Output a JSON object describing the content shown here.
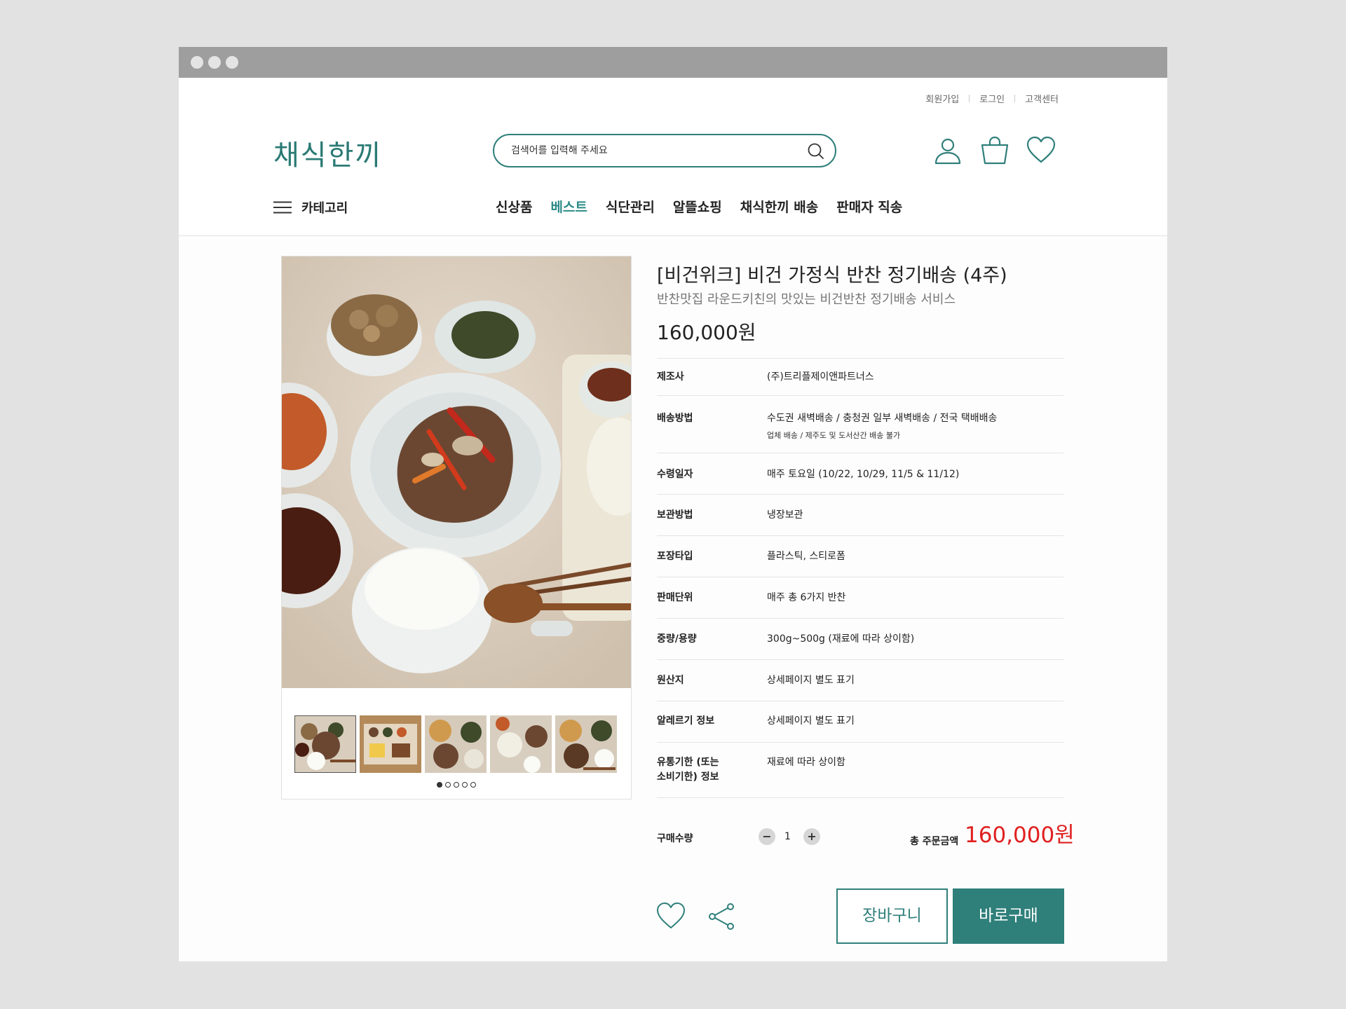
{
  "util_nav": [
    "회원가입",
    "로그인",
    "고객센터"
  ],
  "logo": "채식한끼",
  "search": {
    "placeholder": "검색어를 입력해 주세요"
  },
  "header_icons": [
    "user-icon",
    "shopping-bag-icon",
    "heart-icon"
  ],
  "category_label": "카테고리",
  "gnb": [
    "신상품",
    "베스트",
    "식단관리",
    "알뜰쇼핑",
    "채식한끼 배송",
    "판매자 직송"
  ],
  "gnb_active": "베스트",
  "product": {
    "title": "[비건위크] 비건 가정식 반찬 정기배송 (4주)",
    "subtitle": "반찬맛집 라운드키친의 맛있는 비건반찬 정기배송 서비스",
    "price": "160,000원"
  },
  "specs": [
    {
      "label": "제조사",
      "value": "(주)트리플제이앤파트너스"
    },
    {
      "label": "배송방법",
      "value": "수도권 새벽배송 / 충청권 일부 새벽배송 / 전국 택배배송",
      "note": "업체 배송 / 제주도 및 도서산간 배송 불가"
    },
    {
      "label": "수령일자",
      "value": "매주 토요일 (10/22, 10/29, 11/5 & 11/12)"
    },
    {
      "label": "보관방법",
      "value": "냉장보관"
    },
    {
      "label": "포장타입",
      "value": "플라스틱, 스티로폼"
    },
    {
      "label": "판매단위",
      "value": "매주 총 6가지 반찬"
    },
    {
      "label": "중량/용량",
      "value": "300g~500g (재료에 따라 상이함)"
    },
    {
      "label": "원산지",
      "value": "상세페이지 별도 표기"
    },
    {
      "label": "알레르기 정보",
      "value": "상세페이지 별도 표기"
    },
    {
      "label": "유통기한 (또는\n소비기한) 정보",
      "value": "재료에 따라 상이함"
    }
  ],
  "purchase": {
    "qty_label": "구매수량",
    "qty": "1",
    "minus": "−",
    "plus": "+",
    "total_label": "총 주문금액",
    "total_price": "160,000원",
    "cart_button": "장바구니",
    "buy_button": "바로구매"
  },
  "gallery": {
    "thumb_count": 5,
    "selected_index": 0
  },
  "colors": {
    "brand": "#2f7f7a",
    "accent_red": "#e02020",
    "active_nav": "#2a8a86"
  }
}
